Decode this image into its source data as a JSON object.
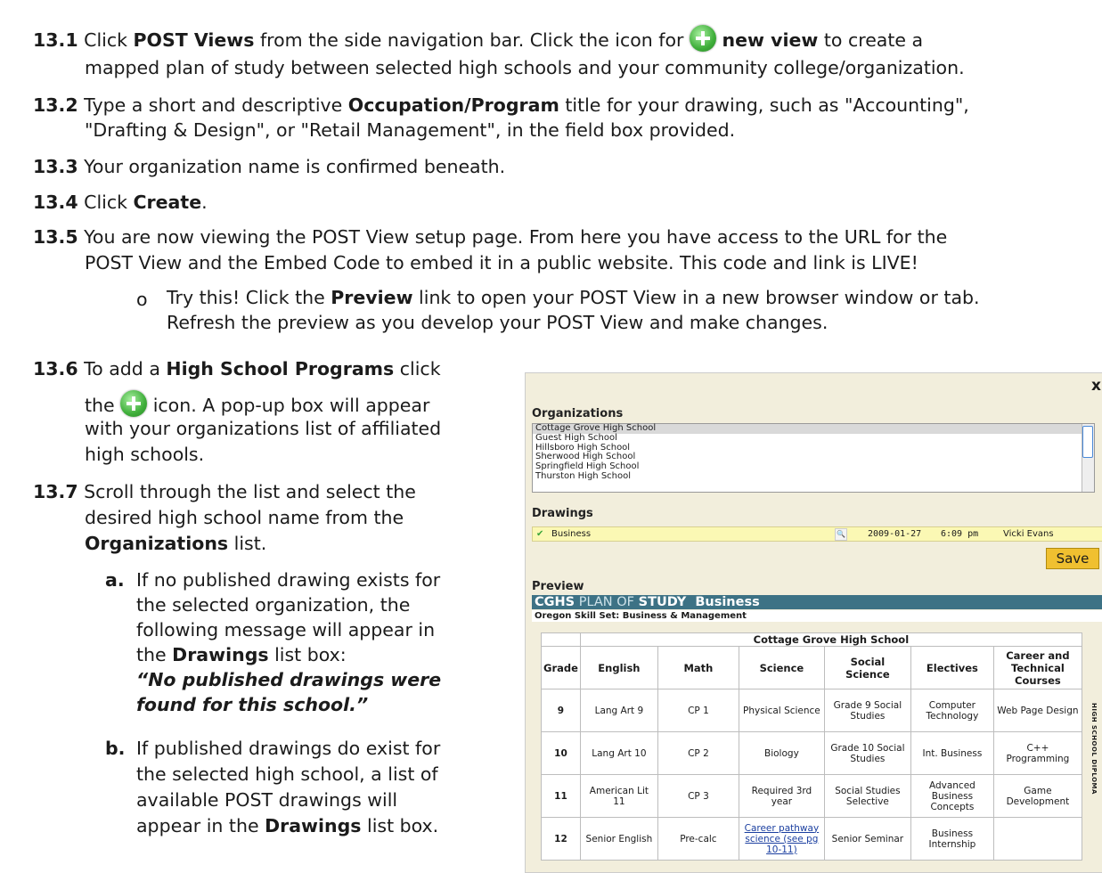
{
  "steps": {
    "s131": {
      "num": "13.1",
      "t1": "Click ",
      "b1": "POST Views",
      "t2": " from the side navigation bar. Click the icon for ",
      "b2": "new view",
      "t3": " to create a",
      "line2": "mapped plan of study between selected high schools and your community college/organization."
    },
    "s132": {
      "num": "13.2",
      "t1": "Type a short and descriptive ",
      "b1": "Occupation/Program",
      "t2": " title for your drawing, such as \"Accounting\",",
      "line2": "\"Drafting & Design\", or \"Retail Management\", in the field box provided."
    },
    "s133": {
      "num": "13.3",
      "t1": "Your organization name is confirmed beneath."
    },
    "s134": {
      "num": "13.4",
      "t1": "Click ",
      "b1": "Create",
      "t2": "."
    },
    "s135": {
      "num": "13.5",
      "line1": "You are now viewing the POST View setup page. From here you have access to the URL for the",
      "line2": "POST View and the Embed Code to embed it in a public website. This code and link is LIVE!"
    },
    "sub_o": {
      "marker": "o",
      "t1": "Try this! Click the ",
      "b1": "Preview",
      "t2": " link to open your POST View in a new browser window or tab.",
      "line2": "Refresh the preview as you develop your POST View and make changes."
    },
    "s136": {
      "num": "13.6",
      "t1": "To add a ",
      "b1": "High School Programs",
      "t2": " click",
      "l2a": "the ",
      "l2b": " icon. A pop-up box will appear",
      "line3": "with your organizations list of affiliated",
      "line4": "high schools."
    },
    "s137": {
      "num": "13.7",
      "line1": "Scroll through the list and select the",
      "line2": "desired high school name from the",
      "b1": "Organizations",
      "t1": " list."
    },
    "sa": {
      "marker": "a.",
      "line1": "If no published drawing exists for",
      "line2": "the selected organization, the",
      "line3": "following message will appear in",
      "l4a": "the ",
      "b1": "Drawings",
      "l4b": " list box:",
      "line5": "“No published drawings were",
      "line6": "found for this school.”"
    },
    "sb": {
      "marker": "b.",
      "line1": "If published drawings do exist for",
      "line2": "the selected high school, a list of",
      "line3": "available POST drawings will",
      "l4a": "appear in the ",
      "b1": "Drawings",
      "l4b": " list box."
    }
  },
  "popup": {
    "close": "x",
    "organizations_label": "Organizations",
    "organizations": [
      "Cottage Grove High School",
      "Guest High School",
      "Hillsboro High School",
      "Sherwood High School",
      "Springfield High School",
      "Thurston High School"
    ],
    "drawings_label": "Drawings",
    "drawing": {
      "name": "Business",
      "date": "2009-01-27",
      "time": "6:09 pm",
      "author": "Vicki Evans"
    },
    "save_label": "Save",
    "preview_label": "Preview",
    "banner": {
      "a": "CGHS",
      "b": " PLAN OF ",
      "c": "STUDY",
      "d": "  Business"
    },
    "skillset": "Oregon Skill Set: Business & Management",
    "school": "Cottage Grove High School",
    "headers": [
      "Grade",
      "English",
      "Math",
      "Science",
      "Social Science",
      "Electives",
      "Career and Technical Courses"
    ],
    "rows": [
      [
        "9",
        "Lang Art 9",
        "CP 1",
        "Physical Science",
        "Grade 9 Social Studies",
        "Computer Technology",
        "Web Page Design"
      ],
      [
        "10",
        "Lang Art 10",
        "CP 2",
        "Biology",
        "Grade 10 Social Studies",
        "Int. Business",
        "C++ Programming"
      ],
      [
        "11",
        "American Lit 11",
        "CP 3",
        "Required 3rd year",
        "Social Studies Selective",
        "Advanced Business Concepts",
        "Game Development"
      ],
      [
        "12",
        "Senior English",
        "Pre-calc",
        "Career pathway science (see pg 10-11)",
        "Senior Seminar",
        "Business Internship",
        ""
      ]
    ],
    "side_label": "HIGH SCHOOL DIPLOMA"
  }
}
